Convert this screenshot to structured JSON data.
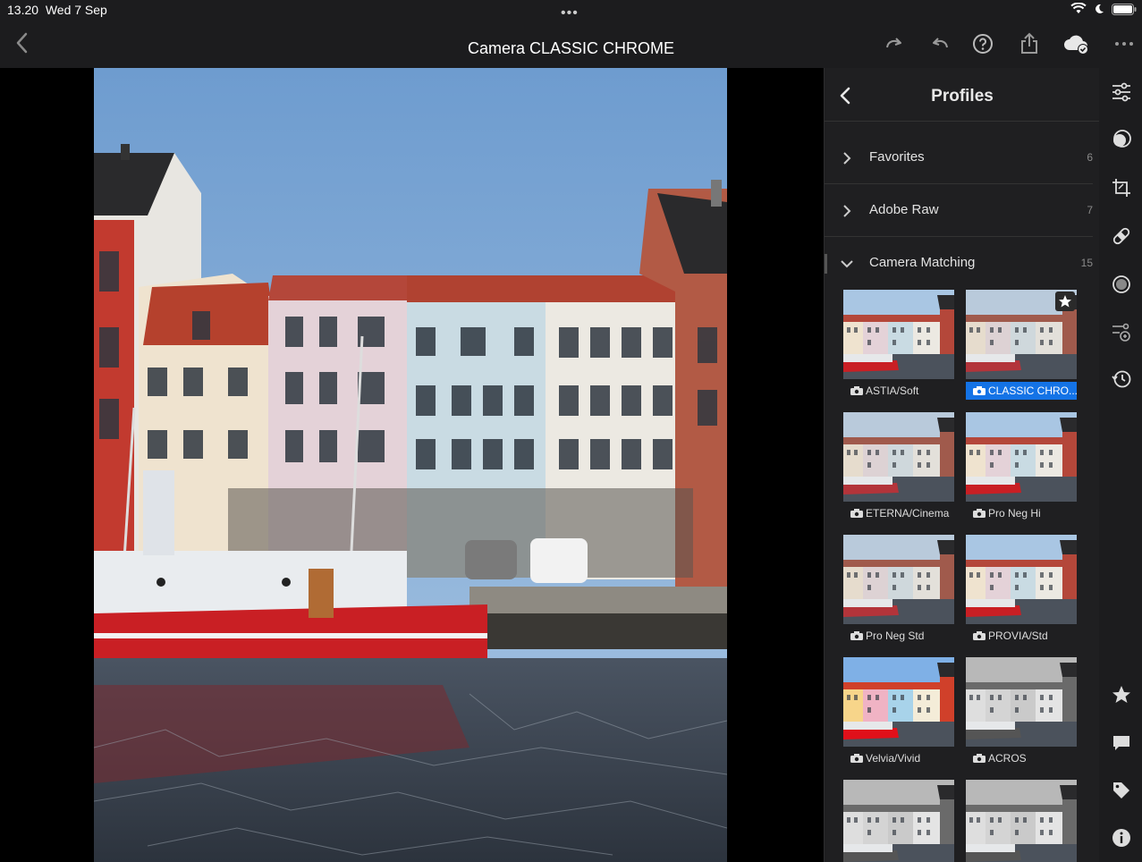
{
  "status_bar": {
    "time": "13.20",
    "date": "Wed 7 Sep",
    "center_dots": "•••"
  },
  "top_bar": {
    "title": "Camera CLASSIC CHROME",
    "icons": [
      "chevron-left-icon",
      "redo-icon",
      "undo-icon",
      "help-icon",
      "share-icon",
      "cloud-synced-icon",
      "more-icon"
    ]
  },
  "panel": {
    "title": "Profiles",
    "groups": [
      {
        "label": "Favorites",
        "count": "6",
        "expanded": false
      },
      {
        "label": "Adobe Raw",
        "count": "7",
        "expanded": false
      },
      {
        "label": "Camera Matching",
        "count": "15",
        "expanded": true
      }
    ],
    "profiles": [
      {
        "label": "ASTIA/Soft",
        "selected": false,
        "favorite": false,
        "tone": "color"
      },
      {
        "label": "CLASSIC CHRO...",
        "selected": true,
        "favorite": true,
        "tone": "muted"
      },
      {
        "label": "ETERNA/Cinema",
        "selected": false,
        "favorite": false,
        "tone": "muted"
      },
      {
        "label": "Pro Neg Hi",
        "selected": false,
        "favorite": false,
        "tone": "color"
      },
      {
        "label": "Pro Neg Std",
        "selected": false,
        "favorite": false,
        "tone": "muted"
      },
      {
        "label": "PROVIA/Std",
        "selected": false,
        "favorite": false,
        "tone": "color"
      },
      {
        "label": "Velvia/Vivid",
        "selected": false,
        "favorite": false,
        "tone": "vivid"
      },
      {
        "label": "ACROS",
        "selected": false,
        "favorite": false,
        "tone": "mono"
      },
      {
        "label": "",
        "selected": false,
        "favorite": false,
        "tone": "mono"
      },
      {
        "label": "",
        "selected": false,
        "favorite": false,
        "tone": "mono"
      }
    ]
  },
  "right_toolbar": {
    "icons": [
      "sliders-icon",
      "presets-icon",
      "crop-icon",
      "healing-icon",
      "masking-icon",
      "versions-icon",
      "history-icon",
      "rating-star-icon",
      "comment-icon",
      "tag-icon",
      "info-icon"
    ]
  },
  "colors": {
    "accent": "#1473e6",
    "panel_bg": "#1f1f21",
    "chrome_bg": "#1c1c1e"
  }
}
